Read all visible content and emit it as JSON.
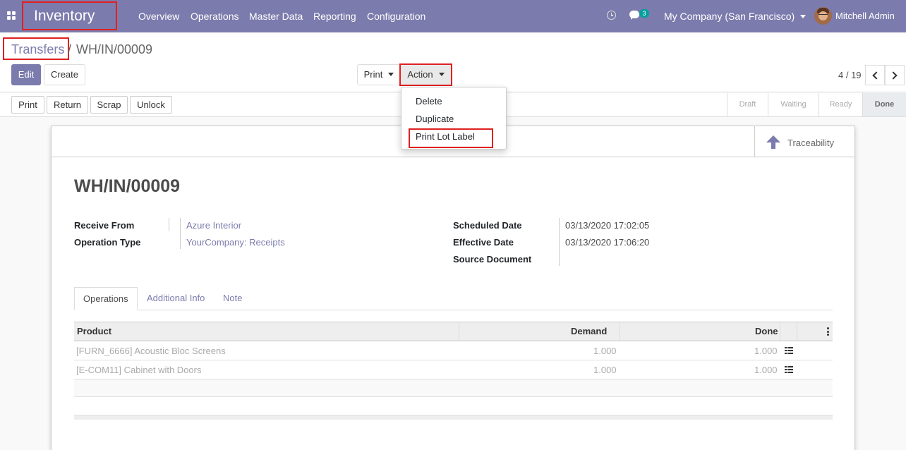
{
  "navbar": {
    "app_title": "Inventory",
    "menu": [
      "Overview",
      "Operations",
      "Master Data",
      "Reporting",
      "Configuration"
    ],
    "chat_count": "3",
    "company": "My Company (San Francisco)",
    "user": "Mitchell Admin",
    "colors": {
      "brand": "#7c7bad",
      "badge": "#00a09d",
      "highlight_box": "#e02020"
    }
  },
  "breadcrumb": {
    "parent": "Transfers",
    "separator": "/",
    "current": "WH/IN/00009"
  },
  "toolbar": {
    "edit_label": "Edit",
    "create_label": "Create",
    "print_label": "Print",
    "action_label": "Action"
  },
  "pager": {
    "value": "4 / 19"
  },
  "action_menu": {
    "items": [
      "Delete",
      "Duplicate",
      "Print Lot Label"
    ]
  },
  "header_buttons": [
    "Print",
    "Return",
    "Scrap",
    "Unlock"
  ],
  "stages": {
    "items": [
      "Draft",
      "Waiting",
      "Ready",
      "Done"
    ],
    "active": "Done"
  },
  "smart_button": {
    "label": "Traceability"
  },
  "record": {
    "title": "WH/IN/00009",
    "receive_from_label": "Receive From",
    "receive_from": "Azure Interior",
    "operation_type_label": "Operation Type",
    "operation_type": "YourCompany: Receipts",
    "scheduled_date_label": "Scheduled Date",
    "scheduled_date": "03/13/2020 17:02:05",
    "effective_date_label": "Effective Date",
    "effective_date": "03/13/2020 17:06:20",
    "source_document_label": "Source Document"
  },
  "tabs": [
    "Operations",
    "Additional Info",
    "Note"
  ],
  "operations_table": {
    "headers": {
      "product": "Product",
      "demand": "Demand",
      "done": "Done"
    },
    "rows": [
      {
        "product": "[FURN_6666] Acoustic Bloc Screens",
        "demand": "1.000",
        "done": "1.000"
      },
      {
        "product": "[E-COM11] Cabinet with Doors",
        "demand": "1.000",
        "done": "1.000"
      }
    ]
  }
}
